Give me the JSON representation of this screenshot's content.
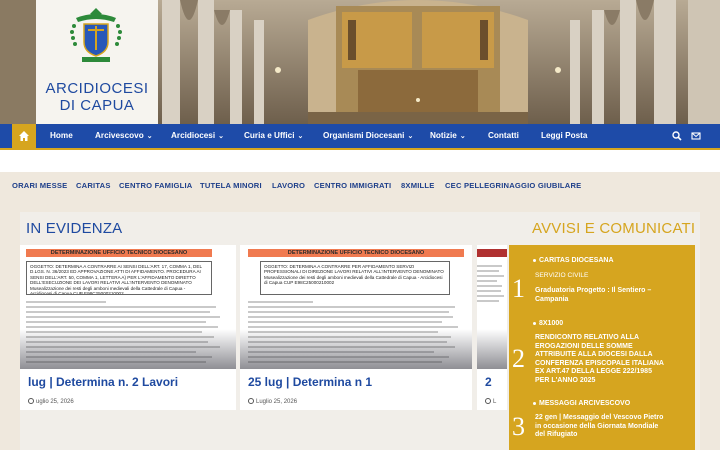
{
  "site": {
    "name_line1": "ARCIDIOCESI",
    "name_line2": "DI CAPUA",
    "crest_icon": "archdiocese-coat-of-arms"
  },
  "nav": {
    "home_icon": "home-icon",
    "items": [
      {
        "label": "Home",
        "dropdown": false
      },
      {
        "label": "Arcivescovo",
        "dropdown": true
      },
      {
        "label": "Arcidiocesi",
        "dropdown": true
      },
      {
        "label": "Curia e Uffici",
        "dropdown": true
      },
      {
        "label": "Organismi Diocesani",
        "dropdown": true
      },
      {
        "label": "Notizie",
        "dropdown": true
      },
      {
        "label": "Contatti",
        "dropdown": false
      },
      {
        "label": "Leggi Posta",
        "dropdown": false
      }
    ],
    "search_icon": "search-icon",
    "mail_icon": "mail-icon"
  },
  "quick_links": [
    "ORARI MESSE",
    "CARITAS",
    "CENTRO FAMIGLIA",
    "TUTELA MINORI",
    "LAVORO",
    "CENTRO IMMIGRATI",
    "8XMILLE",
    "CEC PELLEGRINAGGIO GIUBILARE"
  ],
  "evidenza": {
    "heading": "IN EVIDENZA",
    "cards": [
      {
        "doc_title": "DETERMINAZIONE UFFICIO TECNICO DIOCESANO",
        "doc_box": "OGGETTO: DETERMINA A CONTRARRE AI SENSI DELL'ART. 17, COMMA 1, DEL D.LGS. N. 36/2023 ED APPROVAZIONE ATTI DI AFFIDAMENTO. PROCEDURA AI SENSI DELL'ART. 50, COMMA 1, LETTERA A) PER L'AFFIDAMENTO DIRETTO DELL'ESECUZIONE DEI LAVORI RELATIVI ALL'INTERVENTO DENOMINATO Musealizzazione dei resti degli amboni medievali della Cattedrale di Capua - Arcidiocesi di Capua CUP E98C25000210002",
        "title": "lug | Determina n. 2 Lavori",
        "date": "uglio 25, 2026"
      },
      {
        "doc_title": "DETERMINAZIONE UFFICIO TECNICO DIOCESANO",
        "doc_box": "OGGETTO: DETERMINA A CONTRARRE PER AFFIDAMENTO SERVIZI PROFESSIONALI DI DIREZIONE LAVORI RELATIVI ALL'INTERVENTO DENOMINATO Musealizzazione dei resti degli amboni medievali della Cattedrale di Capua - Arcidiocesi di Capua CUP E98C25000210002",
        "title": "25 lug | Determina n 1",
        "date": "Luglio 25, 2026"
      },
      {
        "doc_title": "",
        "doc_box": "",
        "title": "2",
        "date": "L"
      }
    ]
  },
  "avvisi": {
    "heading": "AVVISI E COMUNICATI",
    "items": [
      {
        "num": "1",
        "category": "CARITAS DIOCESANA",
        "sub": "SERVIZIO CIVILE",
        "text": "Graduatoria Progetto : Il Sentiero – Campania"
      },
      {
        "num": "2",
        "category": "8X1000",
        "sub": "",
        "text": "RENDICONTO RELATIVO ALLA EROGAZIONI DELLE SOMME ATTRIBUITE ALLA DIOCESI DALLA CONFERENZA EPISCOPALE ITALIANA EX ART.47 DELLA LEGGE 222/1985 PER L'ANNO 2025"
      },
      {
        "num": "3",
        "category": "MESSAGGI ARCIVESCOVO",
        "sub": "",
        "text": "22 gen | Messaggio del Vescovo Pietro in occasione della Giornata Mondiale del Rifugiato"
      }
    ]
  },
  "colors": {
    "nav_blue": "#1e4ba8",
    "accent_gold": "#d6a51f",
    "link_blue": "#1f4aa0"
  }
}
